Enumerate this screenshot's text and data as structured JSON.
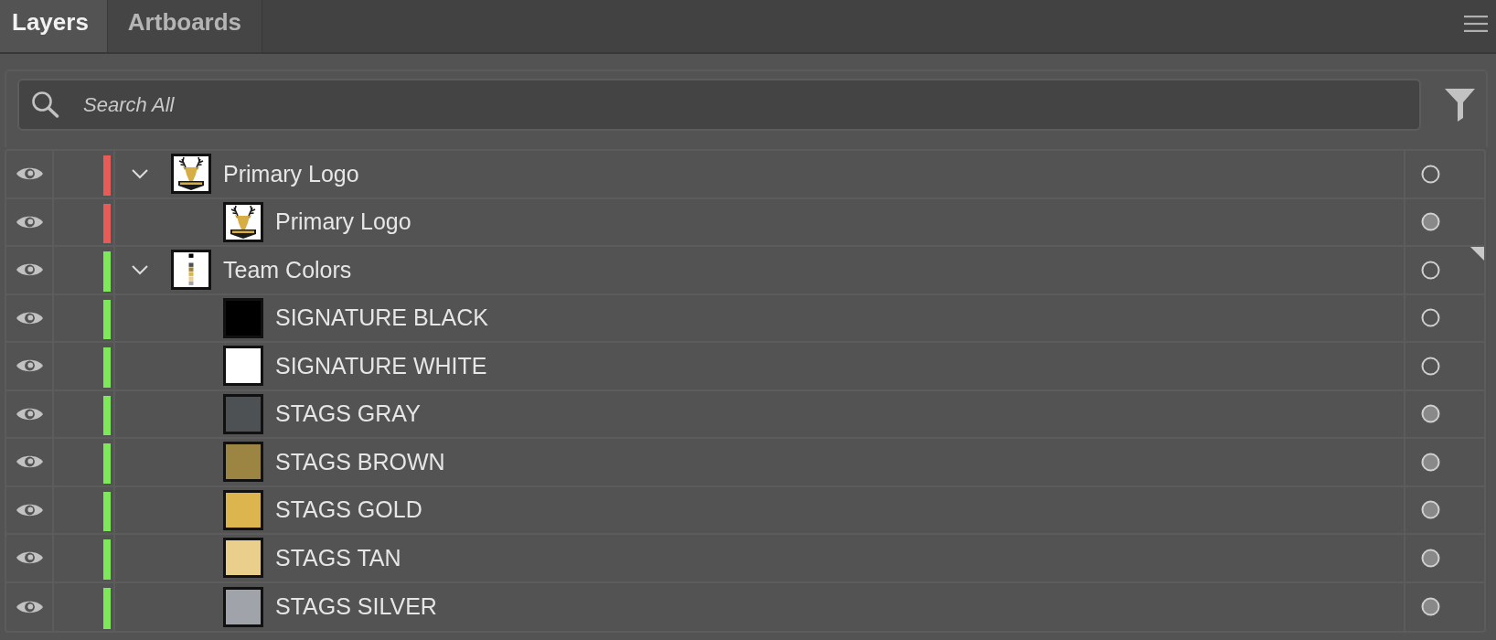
{
  "tabs": [
    {
      "label": "Layers",
      "selected": true
    },
    {
      "label": "Artboards",
      "selected": false
    }
  ],
  "search": {
    "placeholder": "Search All"
  },
  "layers": [
    {
      "name": "Primary Logo",
      "kind": "logo",
      "color": "#e85c58",
      "expanded": true,
      "visible": true,
      "appearance": false,
      "current": false,
      "children": [
        {
          "name": "Primary Logo",
          "kind": "logo",
          "visible": true,
          "appearance": true
        }
      ]
    },
    {
      "name": "Team Colors",
      "kind": "palette",
      "color": "#7ce85a",
      "expanded": true,
      "visible": true,
      "appearance": false,
      "current": true,
      "children": [
        {
          "name": "SIGNATURE BLACK",
          "kind": "swatch",
          "color": "#000000",
          "visible": true,
          "appearance": false
        },
        {
          "name": "SIGNATURE WHITE",
          "kind": "swatch",
          "color": "#ffffff",
          "visible": true,
          "appearance": false
        },
        {
          "name": "STAGS GRAY",
          "kind": "swatch",
          "color": "#4e5154",
          "visible": true,
          "appearance": true
        },
        {
          "name": "STAGS BROWN",
          "kind": "swatch",
          "color": "#9c8542",
          "visible": true,
          "appearance": true
        },
        {
          "name": "STAGS GOLD",
          "kind": "swatch",
          "color": "#dcb54f",
          "visible": true,
          "appearance": true
        },
        {
          "name": "STAGS TAN",
          "kind": "swatch",
          "color": "#eacf8c",
          "visible": true,
          "appearance": true
        },
        {
          "name": "STAGS SILVER",
          "kind": "swatch",
          "color": "#a0a4aa",
          "visible": true,
          "appearance": true
        }
      ]
    }
  ]
}
